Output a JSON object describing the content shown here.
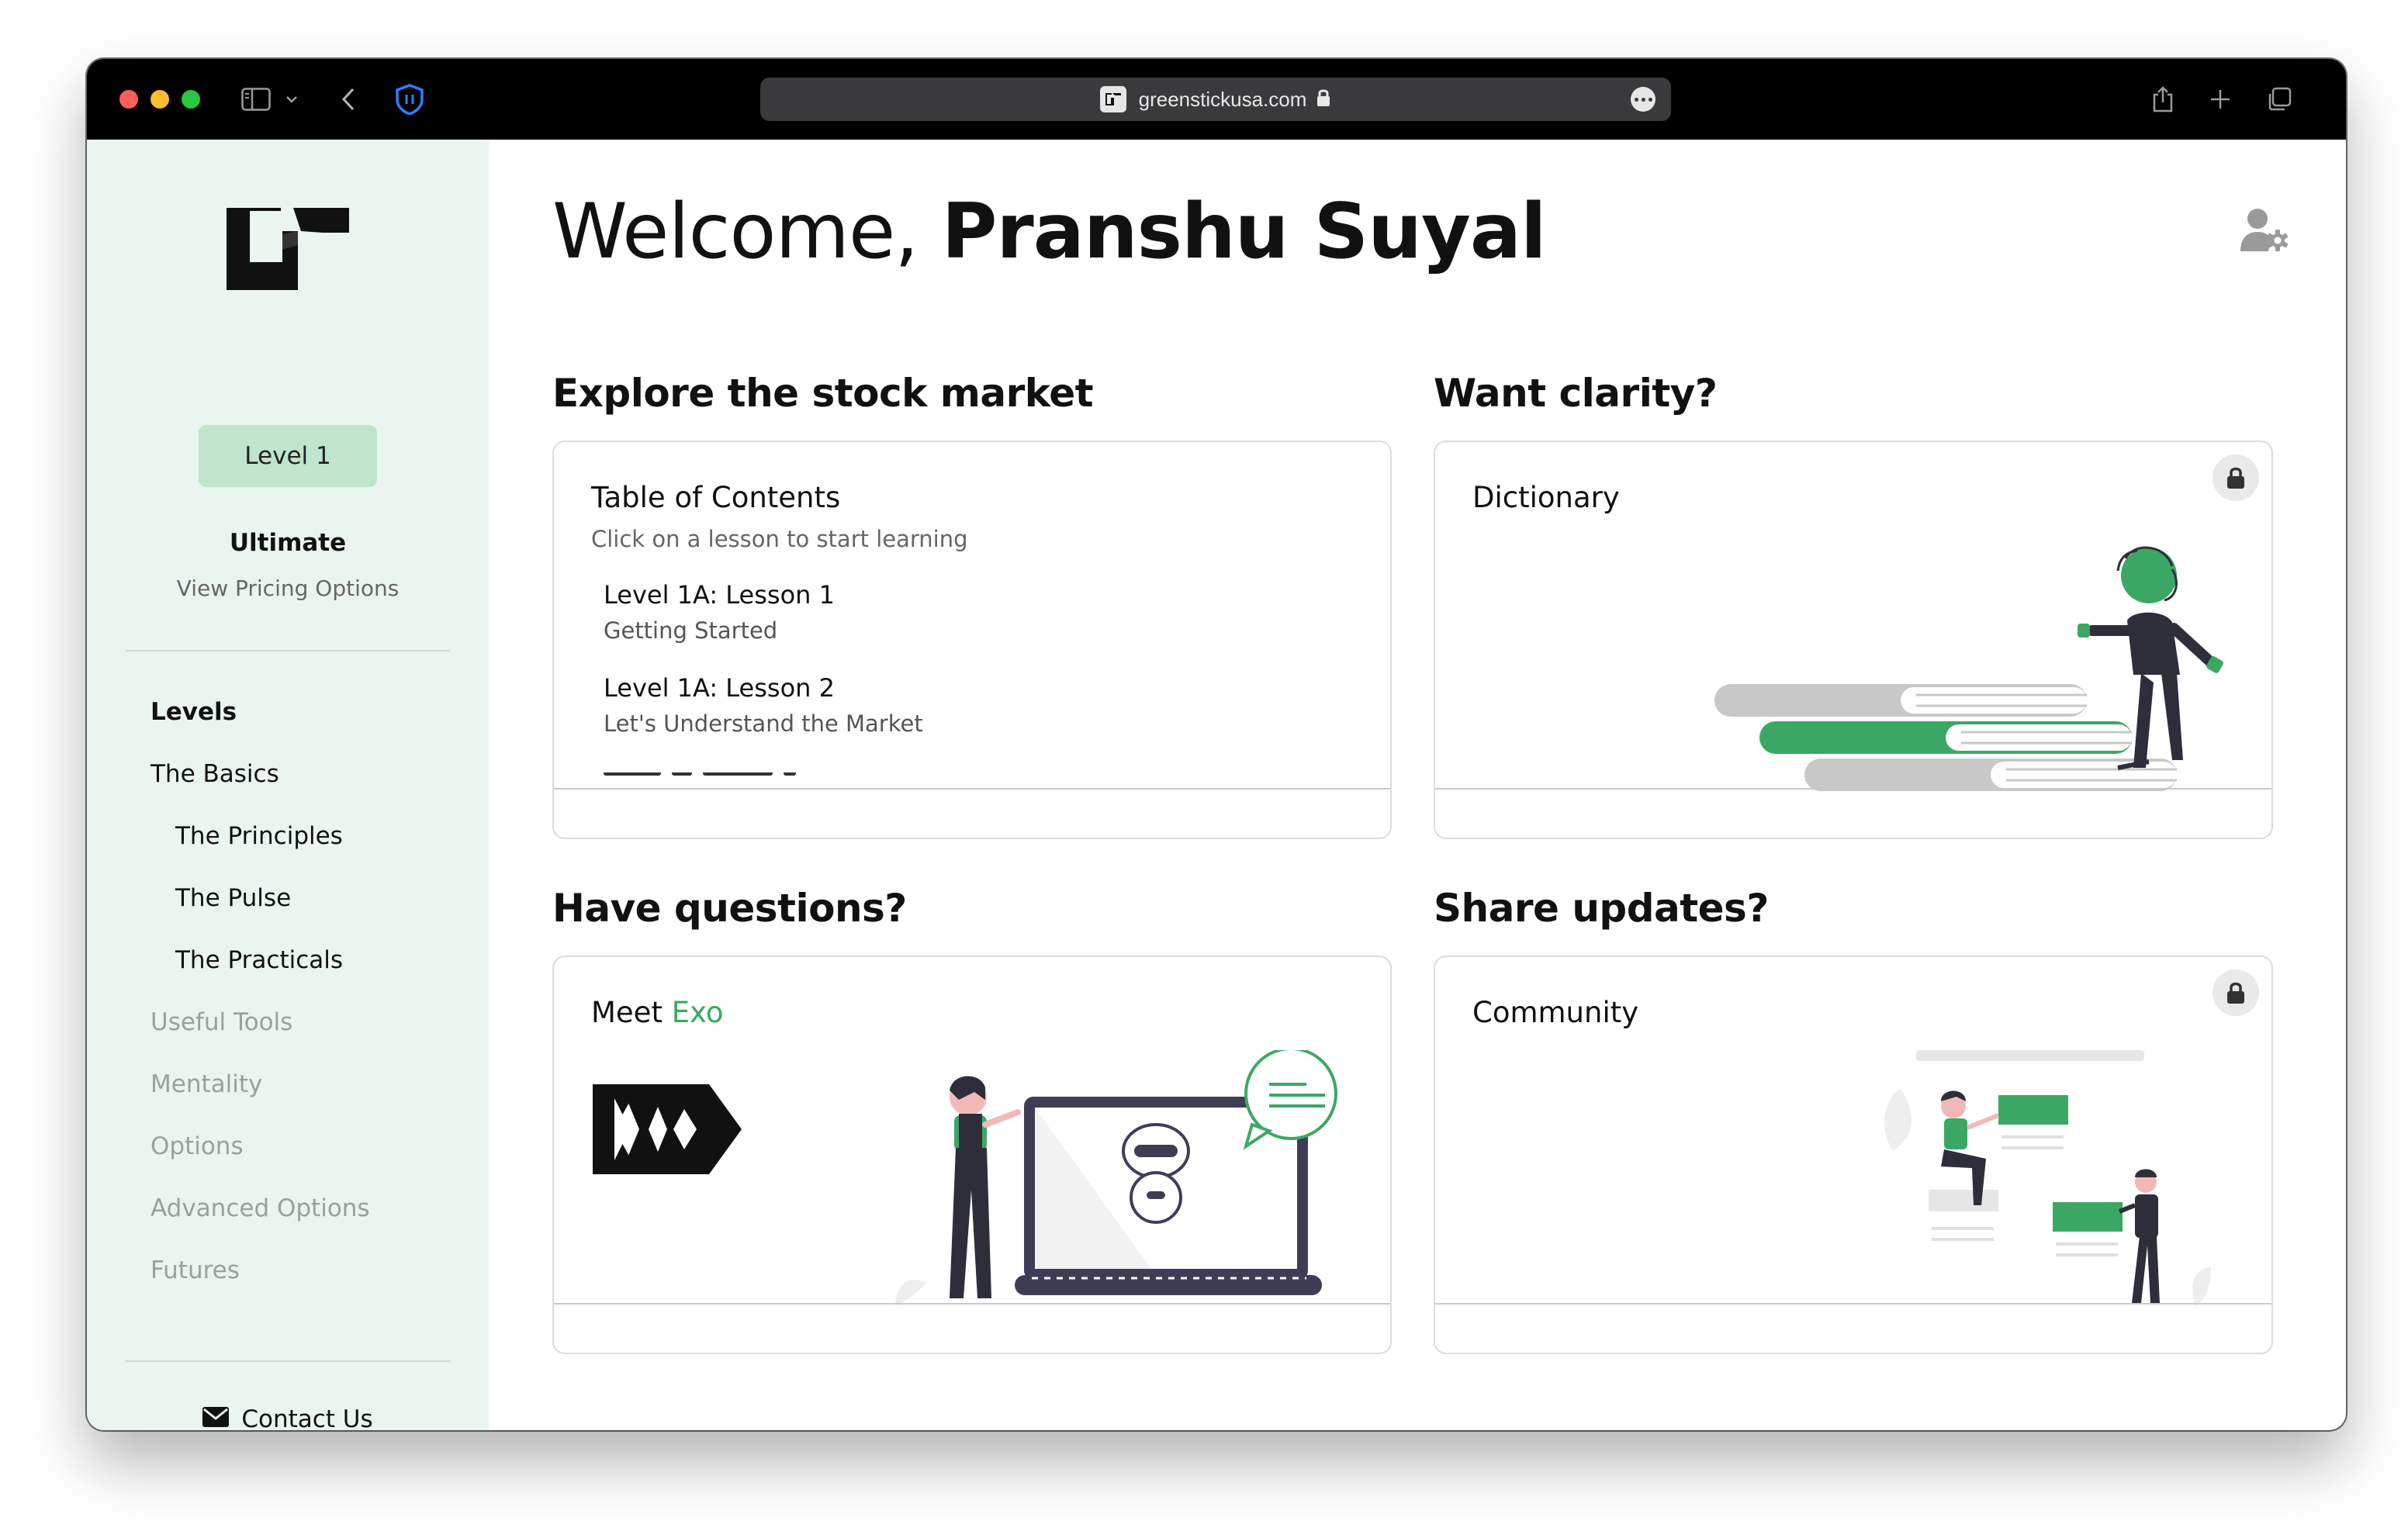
{
  "browser": {
    "url": "greenstickusa.com"
  },
  "sidebar": {
    "level_badge": "Level 1",
    "plan_title": "Ultimate",
    "plan_link": "View Pricing Options",
    "nav": [
      {
        "label": "Levels"
      },
      {
        "label": "The Basics"
      },
      {
        "label": "The Principles"
      },
      {
        "label": "The Pulse"
      },
      {
        "label": "The Practicals"
      },
      {
        "label": "Useful Tools"
      },
      {
        "label": "Mentality"
      },
      {
        "label": "Options"
      },
      {
        "label": "Advanced Options"
      },
      {
        "label": "Futures"
      }
    ],
    "contact": "Contact Us"
  },
  "main": {
    "welcome_prefix": "Welcome, ",
    "user_name": "Pranshu Suyal",
    "sections": {
      "explore": "Explore the stock market",
      "clarity": "Want clarity?",
      "questions": "Have questions?",
      "updates": "Share updates?"
    },
    "toc": {
      "title": "Table of Contents",
      "subtitle": "Click on a lesson to start learning",
      "lessons": [
        {
          "title": "Level 1A: Lesson 1",
          "subtitle": "Getting Started"
        },
        {
          "title": "Level 1A: Lesson 2",
          "subtitle": "Let's Understand the Market"
        }
      ]
    },
    "dictionary": {
      "title": "Dictionary"
    },
    "exo": {
      "title_prefix": "Meet ",
      "title_accent": "Exo"
    },
    "community": {
      "title": "Community"
    }
  },
  "colors": {
    "accent": "#3aa864",
    "sidebar_bg": "#ebf5ef",
    "badge_bg": "#bfe6cc"
  }
}
